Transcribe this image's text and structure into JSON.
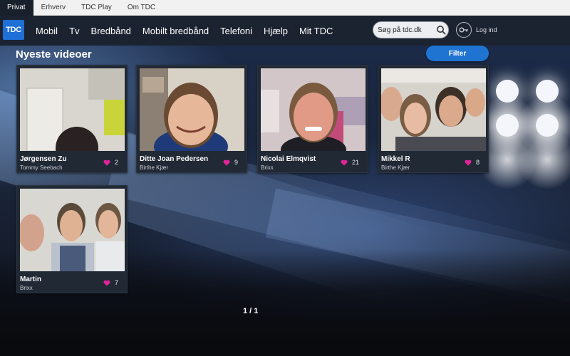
{
  "utility_nav": [
    "Privat",
    "Erhverv",
    "TDC Play",
    "Om TDC"
  ],
  "logo_text": "TDC",
  "main_nav": [
    "Mobil",
    "Tv",
    "Bredbånd",
    "Mobilt bredbånd",
    "Telefoni",
    "Hjælp",
    "Mit TDC"
  ],
  "search": {
    "placeholder": "Søg på tdc.dk",
    "icon": "search-icon"
  },
  "login": {
    "label": "Log ind",
    "icon": "key-icon"
  },
  "page_title": "Nyeste videoer",
  "filter_label": "Filter",
  "colors": {
    "accent": "#1f74d2",
    "heart": "#e0249a",
    "nav_bg": "#1c2330"
  },
  "videos": [
    {
      "name": "Jørgensen Zu",
      "by": "Tommy Seebach",
      "likes": "2"
    },
    {
      "name": "Ditte Joan Pedersen",
      "by": "Birthe Kjær",
      "likes": "9"
    },
    {
      "name": "Nicolai Elmqvist",
      "by": "Brixx",
      "likes": "21"
    },
    {
      "name": "Mikkel R",
      "by": "Birthe Kjær",
      "likes": "8"
    },
    {
      "name": "Martin",
      "by": "Brixx",
      "likes": "7"
    }
  ],
  "pagination": "1 / 1"
}
